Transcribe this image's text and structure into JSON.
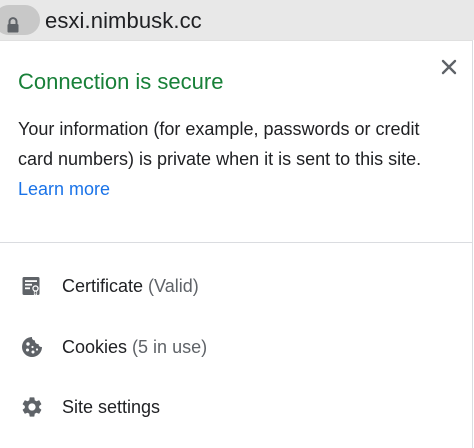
{
  "omnibox": {
    "url": "esxi.nimbusk.cc",
    "lock_icon": "lock-icon"
  },
  "popup": {
    "title": "Connection is secure",
    "description": "Your information (for example, passwords or credit card numbers) is private when it is sent to this site.",
    "learn_more": "Learn more",
    "close_icon": "close-icon",
    "title_color": "#188038",
    "link_color": "#1a73e8"
  },
  "menu": {
    "items": [
      {
        "label": "Certificate",
        "sub": "(Valid)",
        "icon": "certificate-icon"
      },
      {
        "label": "Cookies",
        "sub": "(5 in use)",
        "icon": "cookie-icon"
      },
      {
        "label": "Site settings",
        "sub": "",
        "icon": "gear-icon"
      }
    ]
  }
}
